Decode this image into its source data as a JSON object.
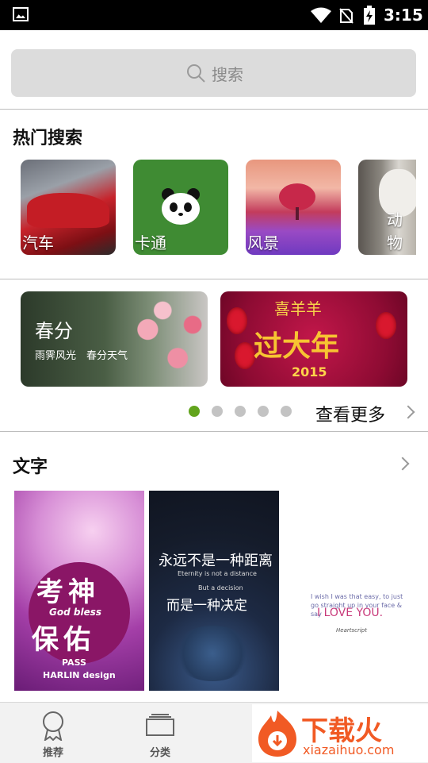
{
  "status_bar": {
    "time": "3:15"
  },
  "search": {
    "placeholder": "搜索"
  },
  "hot_search": {
    "title": "热门搜索",
    "items": [
      {
        "label": "汽车"
      },
      {
        "label": "卡通"
      },
      {
        "label": "风景"
      },
      {
        "label": "动物"
      }
    ]
  },
  "banners": [
    {
      "title": "春分",
      "subtitle": "雨霁风光　春分天气"
    },
    {
      "line1": "喜羊羊",
      "line2": "过大年",
      "year": "2015"
    }
  ],
  "carousel": {
    "active_index": 0,
    "count": 5,
    "more_label": "查看更多"
  },
  "text_section": {
    "title": "文字",
    "items": [
      {
        "line1": "考神",
        "line2": "保佑",
        "bless": "God bless",
        "pass": "PASS",
        "design": "HARLIN design"
      },
      {
        "line1": "永远不是一种距离",
        "en1": "Eternity is not a distance",
        "en2": "But a decision",
        "line2": "而是一种决定"
      },
      {
        "para": "I wish I was that easy, to just go straight up in your face & say",
        "love": "I LOVE YOU.",
        "sig": "Heartscript"
      }
    ]
  },
  "tabbar": {
    "tabs": [
      {
        "label": "推荐",
        "icon": "award-icon"
      },
      {
        "label": "分类",
        "icon": "category-icon"
      }
    ]
  },
  "watermark": {
    "brand": "下载火",
    "domain": "xiazaihuo.com"
  },
  "colors": {
    "accent": "#62a41d",
    "dot_inactive": "#c3c3c3",
    "watermark": "#f15a24"
  }
}
